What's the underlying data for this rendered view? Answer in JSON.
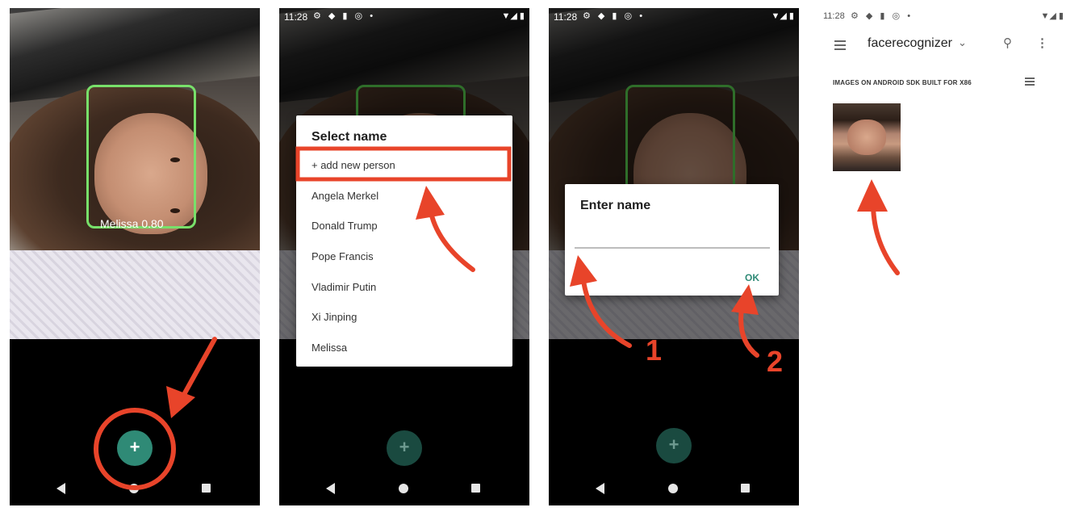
{
  "status_bar": {
    "time": "11:28"
  },
  "panel1": {
    "face_label": "Melissa 0.80",
    "fab_label": "+"
  },
  "panel2": {
    "dialog_title": "Select name",
    "items": [
      "+ add new person",
      "Angela Merkel",
      "Donald Trump",
      "Pope Francis",
      "Vladimir Putin",
      "Xi Jinping",
      "Melissa"
    ],
    "fab_label": "+"
  },
  "panel3": {
    "dialog_title": "Enter name",
    "input_value": "",
    "ok_label": "OK",
    "fab_label": "+",
    "step_labels": [
      "1",
      "2"
    ]
  },
  "panel4": {
    "app_title": "facerecognizer",
    "section_header": "IMAGES ON ANDROID SDK BUILT FOR X86"
  },
  "colors": {
    "accent": "#2f8a76",
    "annotation": "#e8442a",
    "face_box": "#78e06a"
  },
  "icons": [
    "menu-icon",
    "search-icon",
    "more-vert-icon",
    "list-view-icon",
    "chevron-down-icon",
    "back-icon",
    "home-icon",
    "recents-icon",
    "plus-icon"
  ]
}
